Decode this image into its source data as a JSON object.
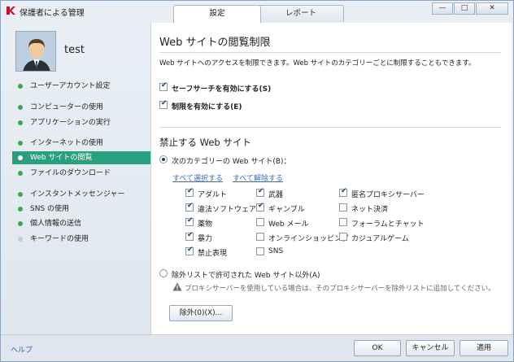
{
  "window": {
    "title": "保護者による管理",
    "tabs": [
      {
        "label": "設定",
        "active": true
      },
      {
        "label": "レポート",
        "active": false
      }
    ],
    "controls": {
      "minimize": "—",
      "maximize": "□",
      "close": "✕"
    }
  },
  "user": {
    "name": "test"
  },
  "sidebar": {
    "items": [
      {
        "label": "ユーザーアカウント設定",
        "status": "green"
      },
      {
        "label": "コンピューターの使用",
        "status": "green"
      },
      {
        "label": "アプリケーションの実行",
        "status": "green"
      },
      {
        "label": "インターネットの使用",
        "status": "green"
      },
      {
        "label": "Web サイトの閲覧",
        "status": "green",
        "active": true
      },
      {
        "label": "ファイルのダウンロード",
        "status": "green"
      },
      {
        "label": "インスタントメッセンジャー",
        "status": "green"
      },
      {
        "label": "SNS の使用",
        "status": "green"
      },
      {
        "label": "個人情報の送信",
        "status": "green"
      },
      {
        "label": "キーワードの使用",
        "status": "grey"
      }
    ],
    "help": "ヘルプ"
  },
  "main": {
    "title": "Web サイトの閲覧制限",
    "description": "Web サイトへのアクセスを制限できます。Web サイトのカテゴリーごとに制限することもできます。",
    "safe_search": {
      "label": "セーフサーチを有効にする(S)",
      "checked": true
    },
    "enable_restriction": {
      "label": "制限を有効にする(E)",
      "checked": true
    },
    "blocked_heading": "禁止する Web サイト",
    "radio_categories": {
      "label": "次のカテゴリーの Web サイト(B)：",
      "selected": true
    },
    "select_all": "すべて選択する",
    "deselect_all": "すべて解除する",
    "categories": [
      {
        "label": "アダルト",
        "checked": true
      },
      {
        "label": "武器",
        "checked": true
      },
      {
        "label": "匿名プロキシサーバー",
        "checked": true
      },
      {
        "label": "違法ソフトウェア",
        "checked": true
      },
      {
        "label": "ギャンブル",
        "checked": true
      },
      {
        "label": "ネット決済",
        "checked": false
      },
      {
        "label": "薬物",
        "checked": true
      },
      {
        "label": "Web メール",
        "checked": false
      },
      {
        "label": "フォーラムとチャット",
        "checked": false
      },
      {
        "label": "暴力",
        "checked": true
      },
      {
        "label": "オンラインショッピング",
        "checked": false
      },
      {
        "label": "カジュアルゲーム",
        "checked": false
      },
      {
        "label": "禁止表現",
        "checked": true
      },
      {
        "label": "SNS",
        "checked": false
      }
    ],
    "radio_exclusions": {
      "label": "除外リストで許可された Web サイト以外(A)",
      "selected": false
    },
    "warning": "プロキシサーバーを使用している場合は、そのプロキシサーバーを除外リストに追加してください。",
    "exclusions_button": "除外(0)(X)..."
  },
  "footer": {
    "ok": "OK",
    "cancel": "キャンセル",
    "apply": "適用"
  },
  "colors": {
    "accent": "#2a9f7d",
    "status_green": "#3aa84e",
    "link": "#2d6fc7"
  }
}
